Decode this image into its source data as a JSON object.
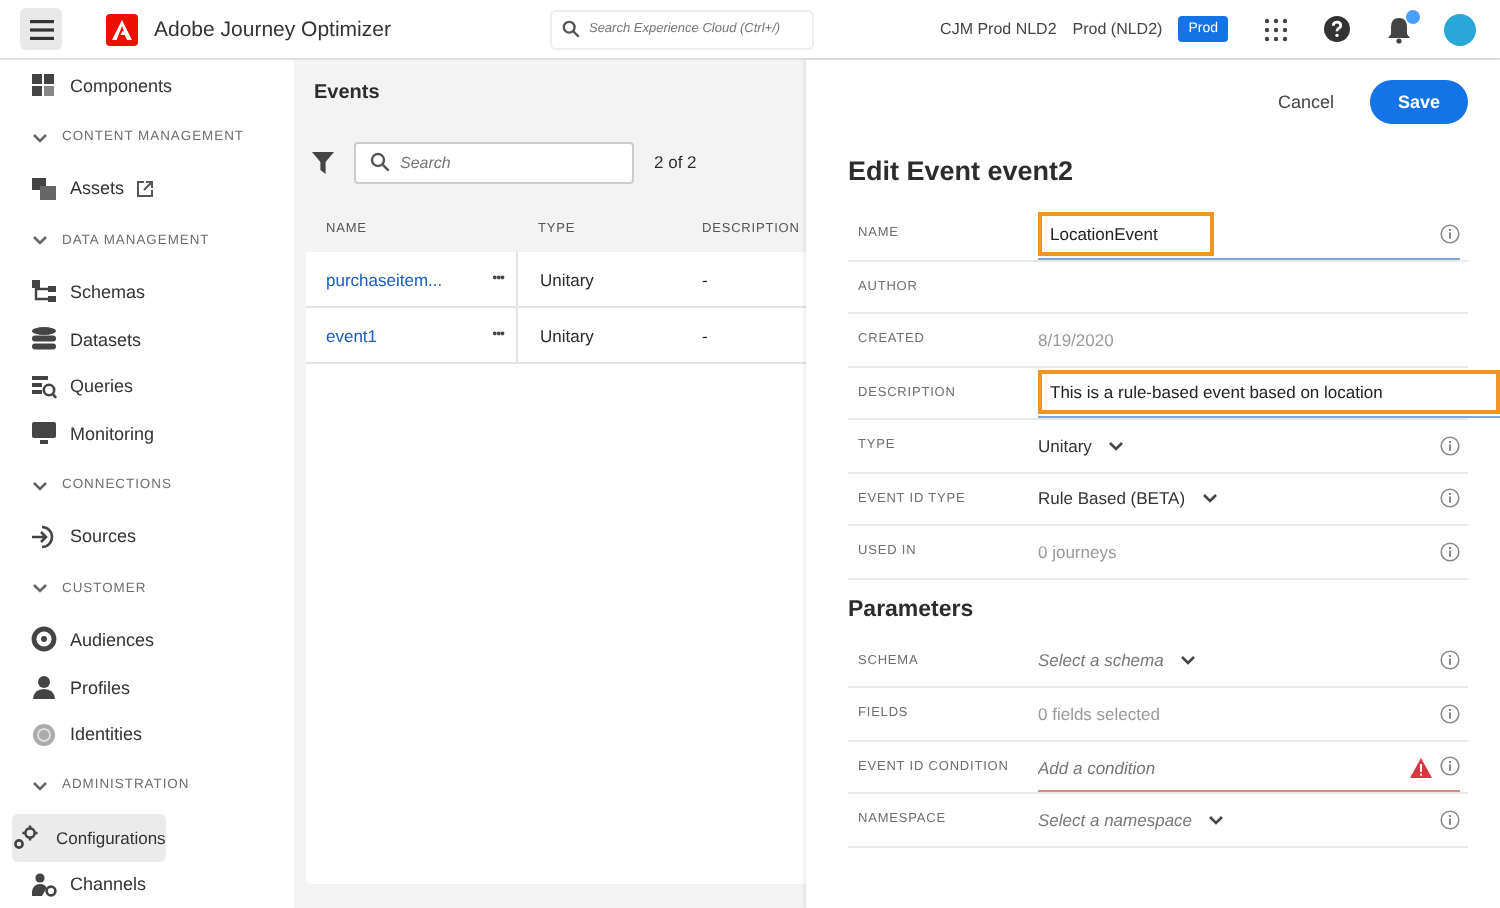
{
  "header": {
    "app_title": "Adobe Journey Optimizer",
    "search": {
      "placeholder": "Search Experience Cloud (Ctrl+/)"
    },
    "org": "CJM Prod NLD2",
    "sandbox": "Prod (NLD2)",
    "environment_badge": "Prod",
    "notifications_unread": true
  },
  "sidebar": {
    "items": [
      {
        "kind": "item",
        "label": "Components",
        "selected": false,
        "external": false
      },
      {
        "kind": "section",
        "label": "CONTENT MANAGEMENT",
        "expanded": true
      },
      {
        "kind": "item",
        "label": "Assets",
        "selected": false,
        "external": true
      },
      {
        "kind": "section",
        "label": "DATA MANAGEMENT",
        "expanded": true
      },
      {
        "kind": "item",
        "label": "Schemas",
        "selected": false,
        "external": false
      },
      {
        "kind": "item",
        "label": "Datasets",
        "selected": false,
        "external": false
      },
      {
        "kind": "item",
        "label": "Queries",
        "selected": false,
        "external": false
      },
      {
        "kind": "item",
        "label": "Monitoring",
        "selected": false,
        "external": false
      },
      {
        "kind": "section",
        "label": "CONNECTIONS",
        "expanded": true
      },
      {
        "kind": "item",
        "label": "Sources",
        "selected": false,
        "external": false
      },
      {
        "kind": "section",
        "label": "CUSTOMER",
        "expanded": true
      },
      {
        "kind": "item",
        "label": "Audiences",
        "selected": false,
        "external": false
      },
      {
        "kind": "item",
        "label": "Profiles",
        "selected": false,
        "external": false
      },
      {
        "kind": "item",
        "label": "Identities",
        "selected": false,
        "external": false
      },
      {
        "kind": "section",
        "label": "ADMINISTRATION",
        "expanded": true
      },
      {
        "kind": "item",
        "label": "Configurations",
        "selected": true,
        "external": false
      },
      {
        "kind": "item",
        "label": "Channels",
        "selected": false,
        "external": false
      }
    ]
  },
  "events": {
    "title": "Events",
    "search": {
      "placeholder": "Search"
    },
    "count": "2 of 2",
    "table": {
      "columns": [
        "NAME",
        "TYPE",
        "DESCRIPTION"
      ],
      "rows": [
        {
          "name": "purchaseitem...",
          "more": "•••",
          "type": "Unitary",
          "description": "-"
        },
        {
          "name": "event1",
          "more": "•••",
          "type": "Unitary",
          "description": "-"
        }
      ]
    }
  },
  "editor": {
    "cancel": "Cancel",
    "save": "Save",
    "title": "Edit Event event2",
    "fields": [
      {
        "label": "NAME",
        "kind": "input",
        "value": "LocationEvent",
        "highlighted": true,
        "info": true
      },
      {
        "label": "AUTHOR",
        "kind": "readonly",
        "info": false
      },
      {
        "label": "CREATED",
        "kind": "readonly",
        "value": "8/19/2020",
        "info": false
      },
      {
        "label": "DESCRIPTION",
        "kind": "input",
        "value": "This is a rule-based event based on location",
        "highlighted": true,
        "info": false
      },
      {
        "label": "TYPE",
        "kind": "select",
        "value": "Unitary",
        "info": true
      },
      {
        "label": "EVENT ID TYPE",
        "kind": "select",
        "value": "Rule Based (BETA)",
        "info": true
      },
      {
        "label": "USED IN",
        "kind": "readonly",
        "value": "0 journeys",
        "info": true
      }
    ],
    "parameters_title": "Parameters",
    "parameters": [
      {
        "label": "SCHEMA",
        "kind": "select",
        "placeholder": "Select a schema",
        "info": true
      },
      {
        "label": "FIELDS",
        "kind": "readonly",
        "value": "0 fields selected",
        "info": true
      },
      {
        "label": "EVENT ID CONDITION",
        "kind": "condition",
        "placeholder": "Add a condition",
        "error": true,
        "info": true
      },
      {
        "label": "NAMESPACE",
        "kind": "select",
        "placeholder": "Select a namespace",
        "info": true
      }
    ]
  }
}
